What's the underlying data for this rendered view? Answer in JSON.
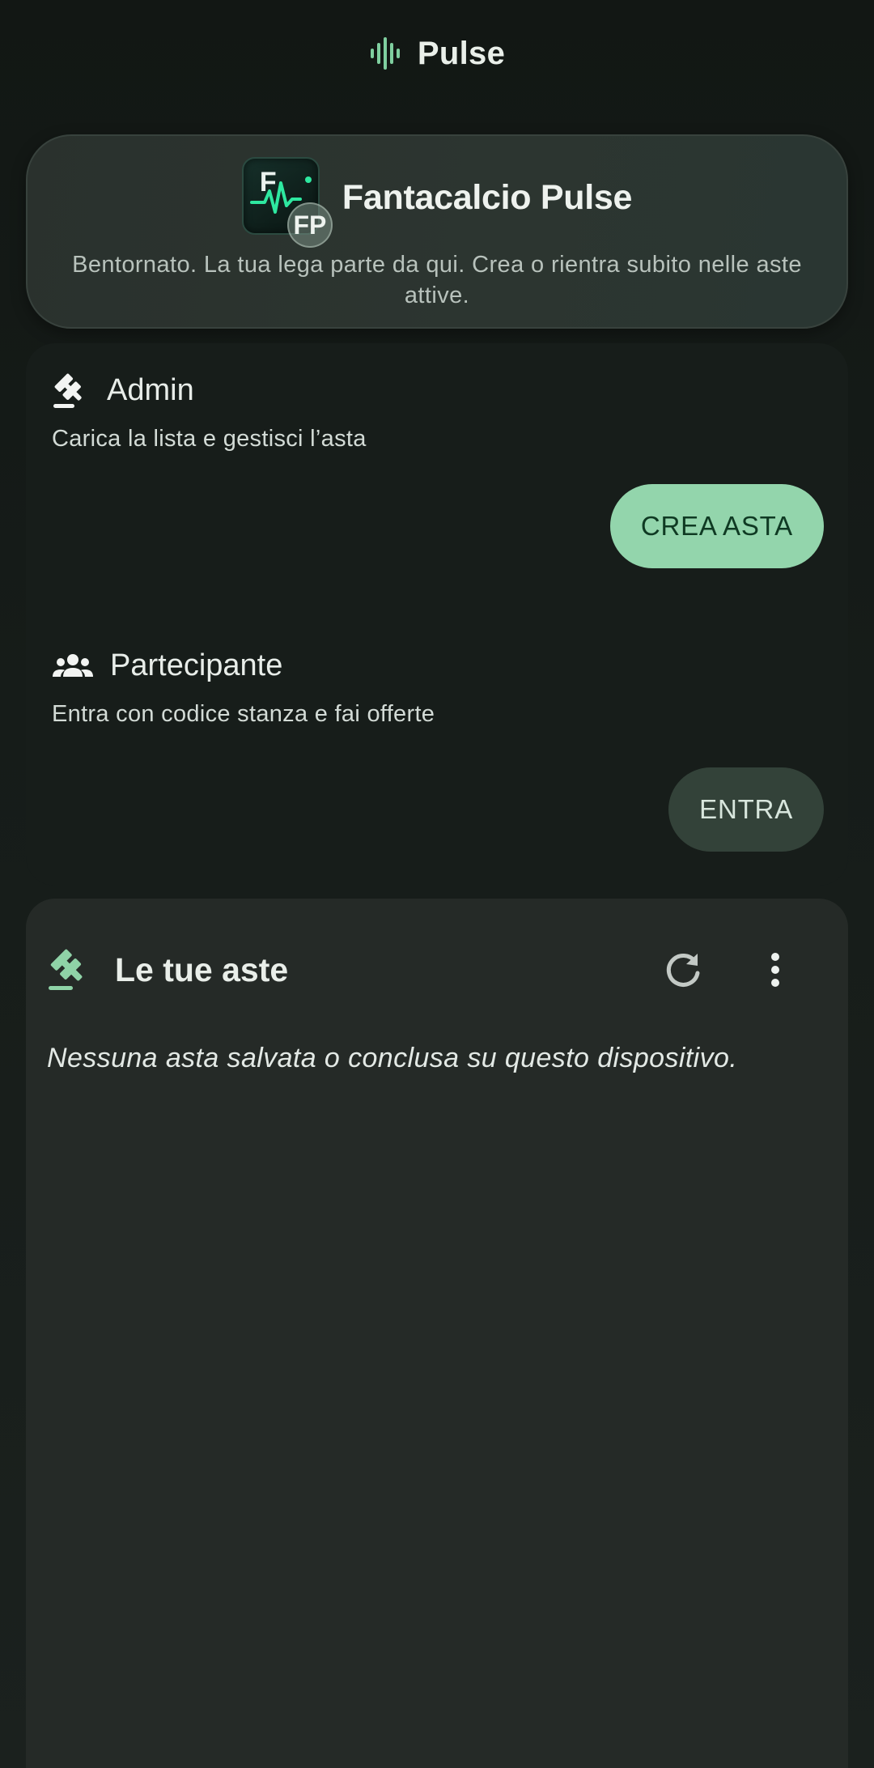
{
  "topbar": {
    "title": "Pulse",
    "icon": "pulse-wave-icon"
  },
  "hero": {
    "logo_letter": "F",
    "logo_badge": "FP",
    "title": "Fantacalcio Pulse",
    "subtitle": "Bentornato. La tua lega parte da qui. Crea o rientra subito nelle aste attive."
  },
  "roles": {
    "admin": {
      "title": "Admin",
      "description": "Carica la lista e gestisci l’asta",
      "button": "CREA ASTA",
      "icon": "gavel-icon"
    },
    "participant": {
      "title": "Partecipante",
      "description": "Entra con codice stanza e fai offerte",
      "button": "ENTRA",
      "icon": "group-icon"
    }
  },
  "auctions": {
    "title": "Le tue aste",
    "empty_message": "Nessuna asta salvata o conclusa su questo dispositivo.",
    "icons": [
      "gavel-icon",
      "refresh-icon",
      "more-vert-icon"
    ]
  },
  "colors": {
    "background": "#141a17",
    "accent": "#93d5ac",
    "accent_text": "#0f3a23",
    "secondary_button": "#334239",
    "card": "#252a27"
  }
}
